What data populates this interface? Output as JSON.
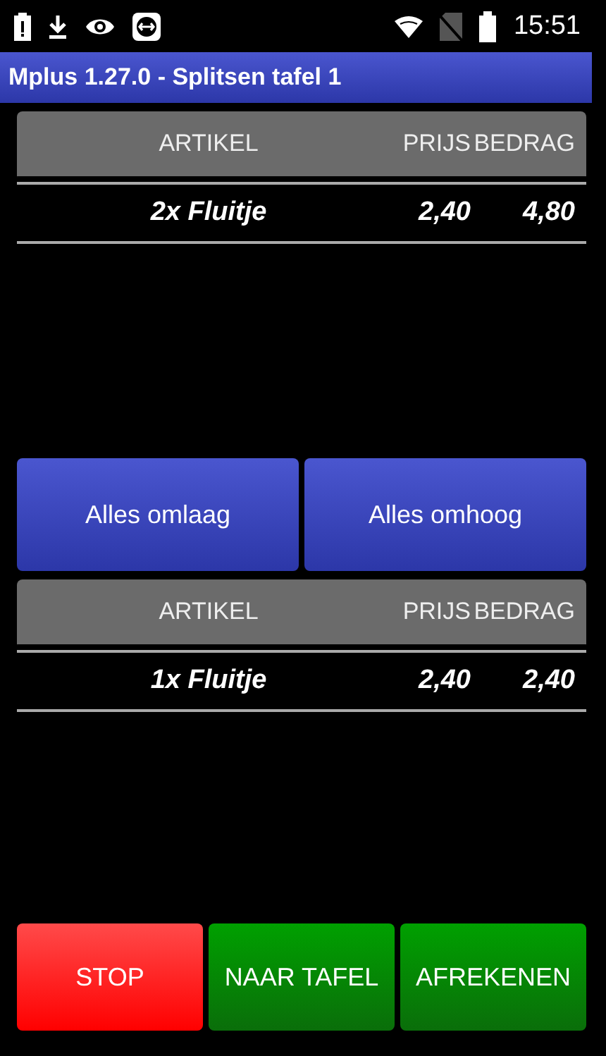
{
  "status_bar": {
    "time": "15:51"
  },
  "window": {
    "title": "Mplus 1.27.0 - Splitsen tafel 1"
  },
  "tables": [
    {
      "columns": [
        "ARTIKEL",
        "PRIJS",
        "BEDRAG"
      ],
      "rows": [
        {
          "article": "2x Fluitje",
          "price": "2,40",
          "amount": "4,80"
        }
      ]
    },
    {
      "columns": [
        "ARTIKEL",
        "PRIJS",
        "BEDRAG"
      ],
      "rows": [
        {
          "article": "1x Fluitje",
          "price": "2,40",
          "amount": "2,40"
        }
      ]
    }
  ],
  "move_buttons": [
    "Alles omlaag",
    "Alles omhoog"
  ],
  "actions": [
    {
      "label": "STOP",
      "kind": "danger"
    },
    {
      "label": "NAAR TAFEL",
      "kind": "confirm"
    },
    {
      "label": "AFREKENEN",
      "kind": "confirm"
    }
  ]
}
